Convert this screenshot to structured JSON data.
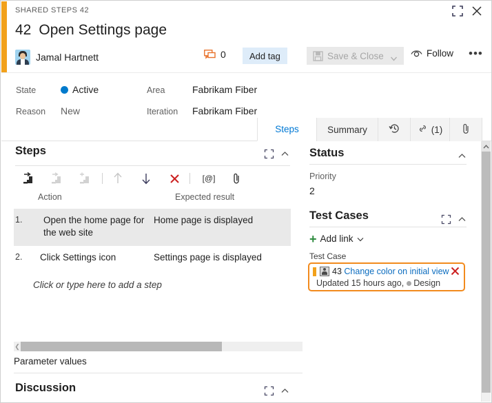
{
  "header": {
    "kicker": "SHARED STEPS 42",
    "id": "42",
    "title": "Open Settings page",
    "assigned_to": "Jamal Hartnett",
    "comment_count": "0",
    "add_tag_label": "Add tag",
    "save_close_label": "Save & Close",
    "follow_label": "Follow",
    "more_label": "•••",
    "expand_icon": "expand-icon",
    "close_icon": "close-icon",
    "accent_color": "#f2a11b"
  },
  "fields": {
    "state_label": "State",
    "state_value": "Active",
    "state_color": "#007acc",
    "reason_label": "Reason",
    "reason_value": "New",
    "area_label": "Area",
    "area_value": "Fabrikam Fiber",
    "iteration_label": "Iteration",
    "iteration_value": "Fabrikam Fiber"
  },
  "tabs": [
    {
      "label": "Steps",
      "icon": "",
      "active": true
    },
    {
      "label": "Summary",
      "icon": "",
      "active": false
    },
    {
      "label": "",
      "icon": "history-icon",
      "active": false
    },
    {
      "label": "(1)",
      "icon": "link-icon",
      "active": false
    },
    {
      "label": "",
      "icon": "paperclip-icon",
      "active": false
    }
  ],
  "steps_section": {
    "title": "Steps",
    "toolbar": [
      {
        "name": "insert-step-icon",
        "enabled": true
      },
      {
        "name": "insert-shared-steps-icon",
        "enabled": false
      },
      {
        "name": "create-shared-steps-icon",
        "enabled": false
      },
      {
        "name": "move-up-icon",
        "enabled": false
      },
      {
        "name": "move-down-icon",
        "enabled": true
      },
      {
        "name": "delete-step-icon",
        "enabled": true
      },
      {
        "name": "insert-parameter-icon",
        "enabled": true,
        "label": "[@]"
      },
      {
        "name": "attach-file-icon",
        "enabled": true
      }
    ],
    "columns": [
      "Action",
      "Expected result"
    ],
    "rows": [
      {
        "num": "1.",
        "action": "Open the home page for the web site",
        "expected": "Home page is displayed",
        "selected": true
      },
      {
        "num": "2.",
        "action": "Click Settings icon",
        "expected": "Settings page is displayed",
        "selected": false
      }
    ],
    "add_step_placeholder": "Click or type here to add a step",
    "parameter_values_label": "Parameter values"
  },
  "discussion_section": {
    "title": "Discussion"
  },
  "status_section": {
    "title": "Status",
    "priority_label": "Priority",
    "priority_value": "2"
  },
  "test_cases_section": {
    "title": "Test Cases",
    "add_link_label": "Add link",
    "group_label": "Test Case",
    "link": {
      "id": "43",
      "title": "Change color on initial view",
      "subtitle_prefix": "Updated 15 hours ago,",
      "state": "Design",
      "highlight_color": "#f28a1c",
      "icon": "test-case-icon",
      "remove_icon": "remove-link-icon"
    }
  }
}
